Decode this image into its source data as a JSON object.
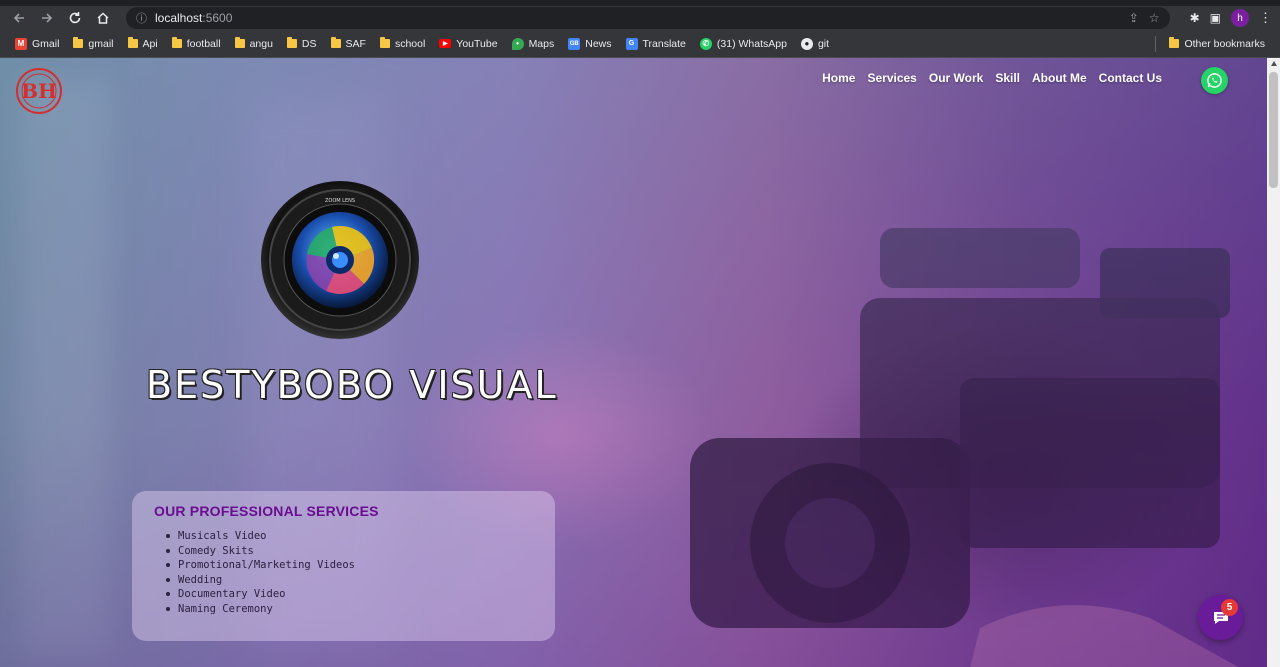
{
  "browser": {
    "url_host": "localhost",
    "url_port": ":5600",
    "profile_initial": "h",
    "bookmarks": [
      {
        "label": "Gmail",
        "icon": "gmail-icon"
      },
      {
        "label": "gmail",
        "icon": "folder-icon"
      },
      {
        "label": "Api",
        "icon": "folder-icon"
      },
      {
        "label": "football",
        "icon": "folder-icon"
      },
      {
        "label": "angu",
        "icon": "folder-icon"
      },
      {
        "label": "DS",
        "icon": "folder-icon"
      },
      {
        "label": "SAF",
        "icon": "folder-icon"
      },
      {
        "label": "school",
        "icon": "folder-icon"
      },
      {
        "label": "YouTube",
        "icon": "youtube-icon"
      },
      {
        "label": "Maps",
        "icon": "maps-icon"
      },
      {
        "label": "News",
        "icon": "news-icon"
      },
      {
        "label": "Translate",
        "icon": "translate-icon"
      },
      {
        "label": "(31) WhatsApp",
        "icon": "whatsapp-icon"
      },
      {
        "label": "git",
        "icon": "github-icon"
      }
    ],
    "other_bookmarks": "Other bookmarks"
  },
  "site": {
    "nav": [
      "Home",
      "Services",
      "Our Work",
      "Skill",
      "About Me",
      "Contact Us"
    ],
    "brand": "BESTYBOBO VISUAL",
    "services_title": "OUR PROFESSIONAL SERVICES",
    "services": [
      "Musicals Video",
      "Comedy Skits",
      "Promotional/Marketing Videos",
      "Wedding",
      "Documentary Video",
      "Naming Ceremony"
    ],
    "chat_badge": "5",
    "accent": "#6a0d91",
    "whatsapp_color": "#25d366"
  }
}
